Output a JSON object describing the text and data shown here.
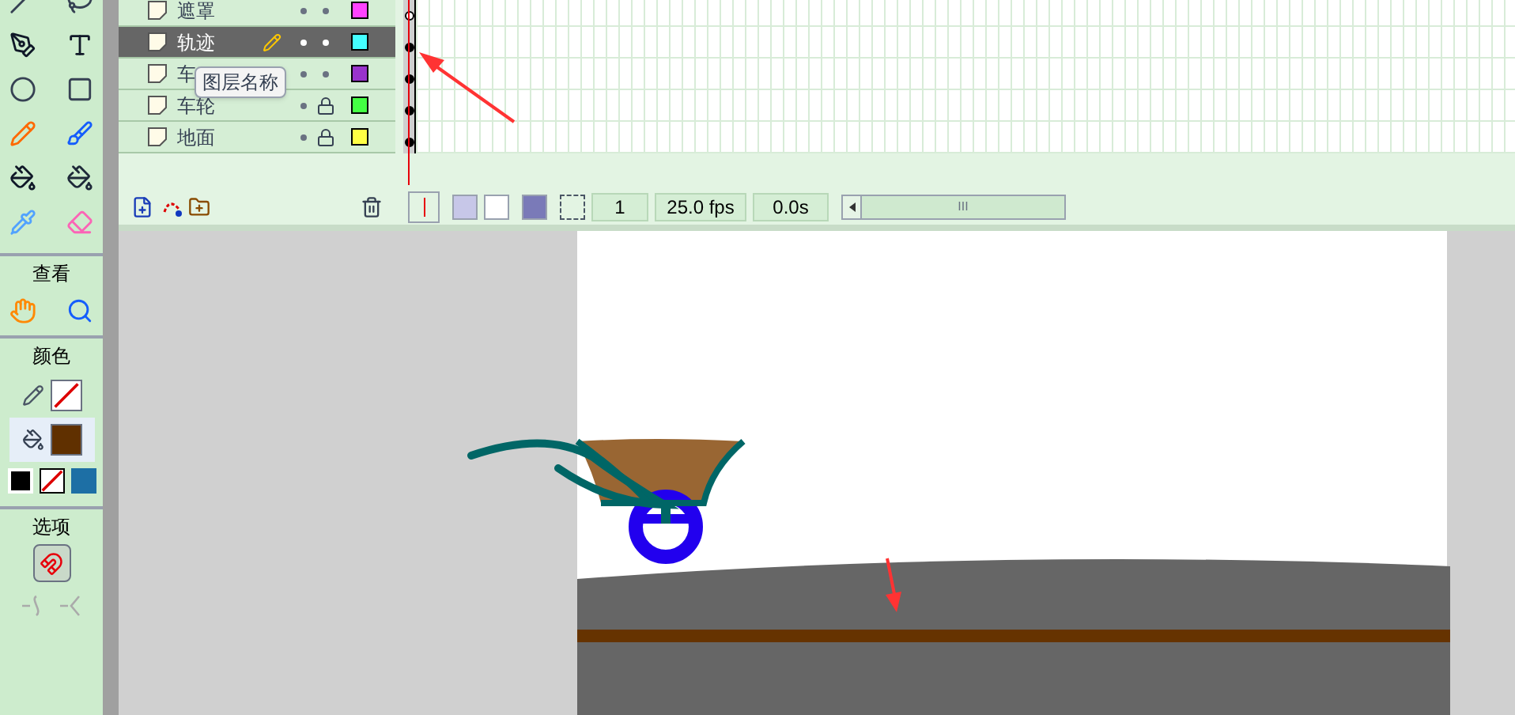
{
  "tools": {
    "sections": [
      {
        "title": "查看"
      },
      {
        "title": "颜色"
      },
      {
        "title": "选项"
      }
    ]
  },
  "timeline": {
    "layers": [
      {
        "name": "遮罩",
        "selected": false,
        "locked": false,
        "color": "#ff44ff",
        "keyframe_filled": false
      },
      {
        "name": "轨迹",
        "selected": true,
        "locked": false,
        "color": "#44ffff",
        "keyframe_filled": true
      },
      {
        "name": "车",
        "selected": false,
        "locked": false,
        "color": "#9933cc",
        "keyframe_filled": true
      },
      {
        "name": "车轮",
        "selected": false,
        "locked": true,
        "color": "#44ff44",
        "keyframe_filled": true
      },
      {
        "name": "地面",
        "selected": false,
        "locked": true,
        "color": "#ffff44",
        "keyframe_filled": true
      }
    ],
    "tooltip": "图层名称",
    "current_frame": "1",
    "frame_rate": "25.0 fps",
    "elapsed_time": "0.0s",
    "scroll_grip": "III"
  }
}
